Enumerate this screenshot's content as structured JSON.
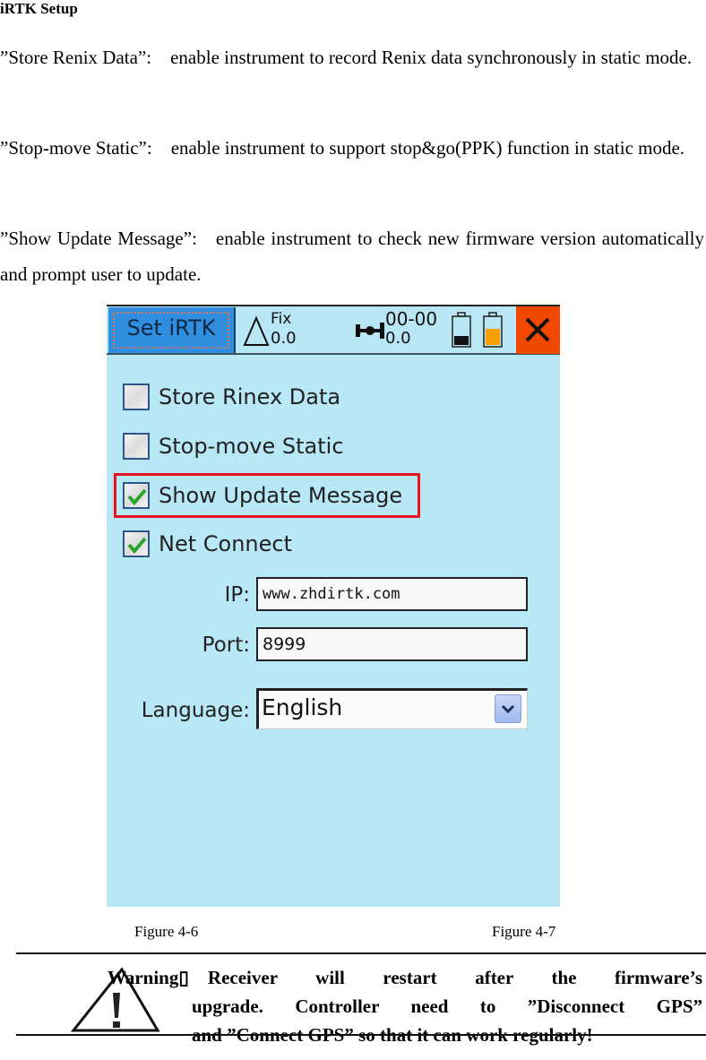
{
  "document": {
    "section_title": "iRTK Setup",
    "paragraphs": [
      "”Store Renix Data”: enable instrument to record Renix data synchronously in static mode.",
      "”Stop-move Static”: enable instrument to support stop&go(PPK) function in static mode.",
      "”Show Update Message”: enable instrument to check new firmware version automatically and prompt user to update."
    ],
    "captions": [
      "Figure 4-6",
      "Figure 4-7"
    ],
    "warning": {
      "line1": "Warning▯ Receiver will restart after the firmware’s",
      "line2": "upgrade. Controller need to ”Disconnect GPS”",
      "line3": "and ”Connect GPS” so that it can work regularly!",
      "icon": "warning-triangle-icon"
    }
  },
  "device": {
    "topbar": {
      "title_button": "Set iRTK",
      "fix_label": "Fix",
      "fix_value": "0.0",
      "sat_label": "00-00",
      "sat_value": "0.0",
      "battery1_level": 0.35,
      "battery2_level": 0.55,
      "colors": {
        "title_bg": "#2f8ee0",
        "close_bg": "#f04800",
        "battery2_fill": "#f5a000"
      },
      "icons": [
        "triangle-icon",
        "satellite-icon",
        "battery-icon",
        "battery-icon",
        "close-icon"
      ]
    },
    "options": [
      {
        "label": "Store Rinex Data",
        "checked": false
      },
      {
        "label": "Stop-move Static",
        "checked": false
      },
      {
        "label": "Show Update Message",
        "checked": true,
        "highlighted": true
      },
      {
        "label": "Net Connect",
        "checked": true
      }
    ],
    "fields": {
      "ip_label": "IP:",
      "ip_value": "www.zhdirtk.com",
      "port_label": "Port:",
      "port_value": "8999",
      "language_label": "Language:",
      "language_value": "English"
    },
    "colors": {
      "background": "#b8e7f6",
      "highlight_border": "#e6141e",
      "check": "#2aa52a"
    }
  }
}
